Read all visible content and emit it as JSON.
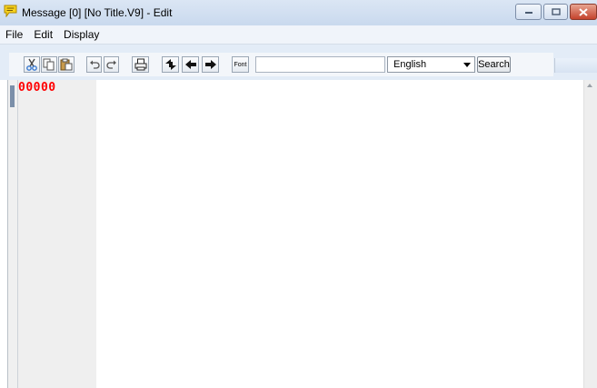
{
  "window": {
    "title": "Message [0] [No Title.V9] - Edit"
  },
  "menu": {
    "items": [
      "File",
      "Edit",
      "Display"
    ]
  },
  "toolbar": {
    "font_label": "Font",
    "search_value": "",
    "language_selected": "English",
    "search_label": "Search"
  },
  "editor": {
    "line_number": "00000",
    "line_number_color": "#ff0000"
  },
  "colors": {
    "accent_close": "#c4432c",
    "title_icon": "#f2c200"
  }
}
